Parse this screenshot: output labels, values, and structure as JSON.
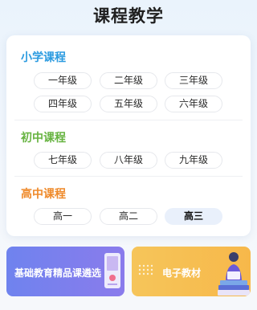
{
  "title": "课程教学",
  "sections": [
    {
      "title": "小学课程",
      "color": "#2b9be0",
      "grades": [
        "一年级",
        "二年级",
        "三年级",
        "四年级",
        "五年级",
        "六年级"
      ]
    },
    {
      "title": "初中课程",
      "color": "#66b340",
      "grades": [
        "七年级",
        "八年级",
        "九年级"
      ]
    },
    {
      "title": "高中课程",
      "color": "#ef8a2a",
      "grades": [
        "高一",
        "高二",
        "高三"
      ],
      "selected": "高三"
    }
  ],
  "banners": {
    "left_label": "基础教育精品课遴选",
    "right_label": "电子教材"
  }
}
